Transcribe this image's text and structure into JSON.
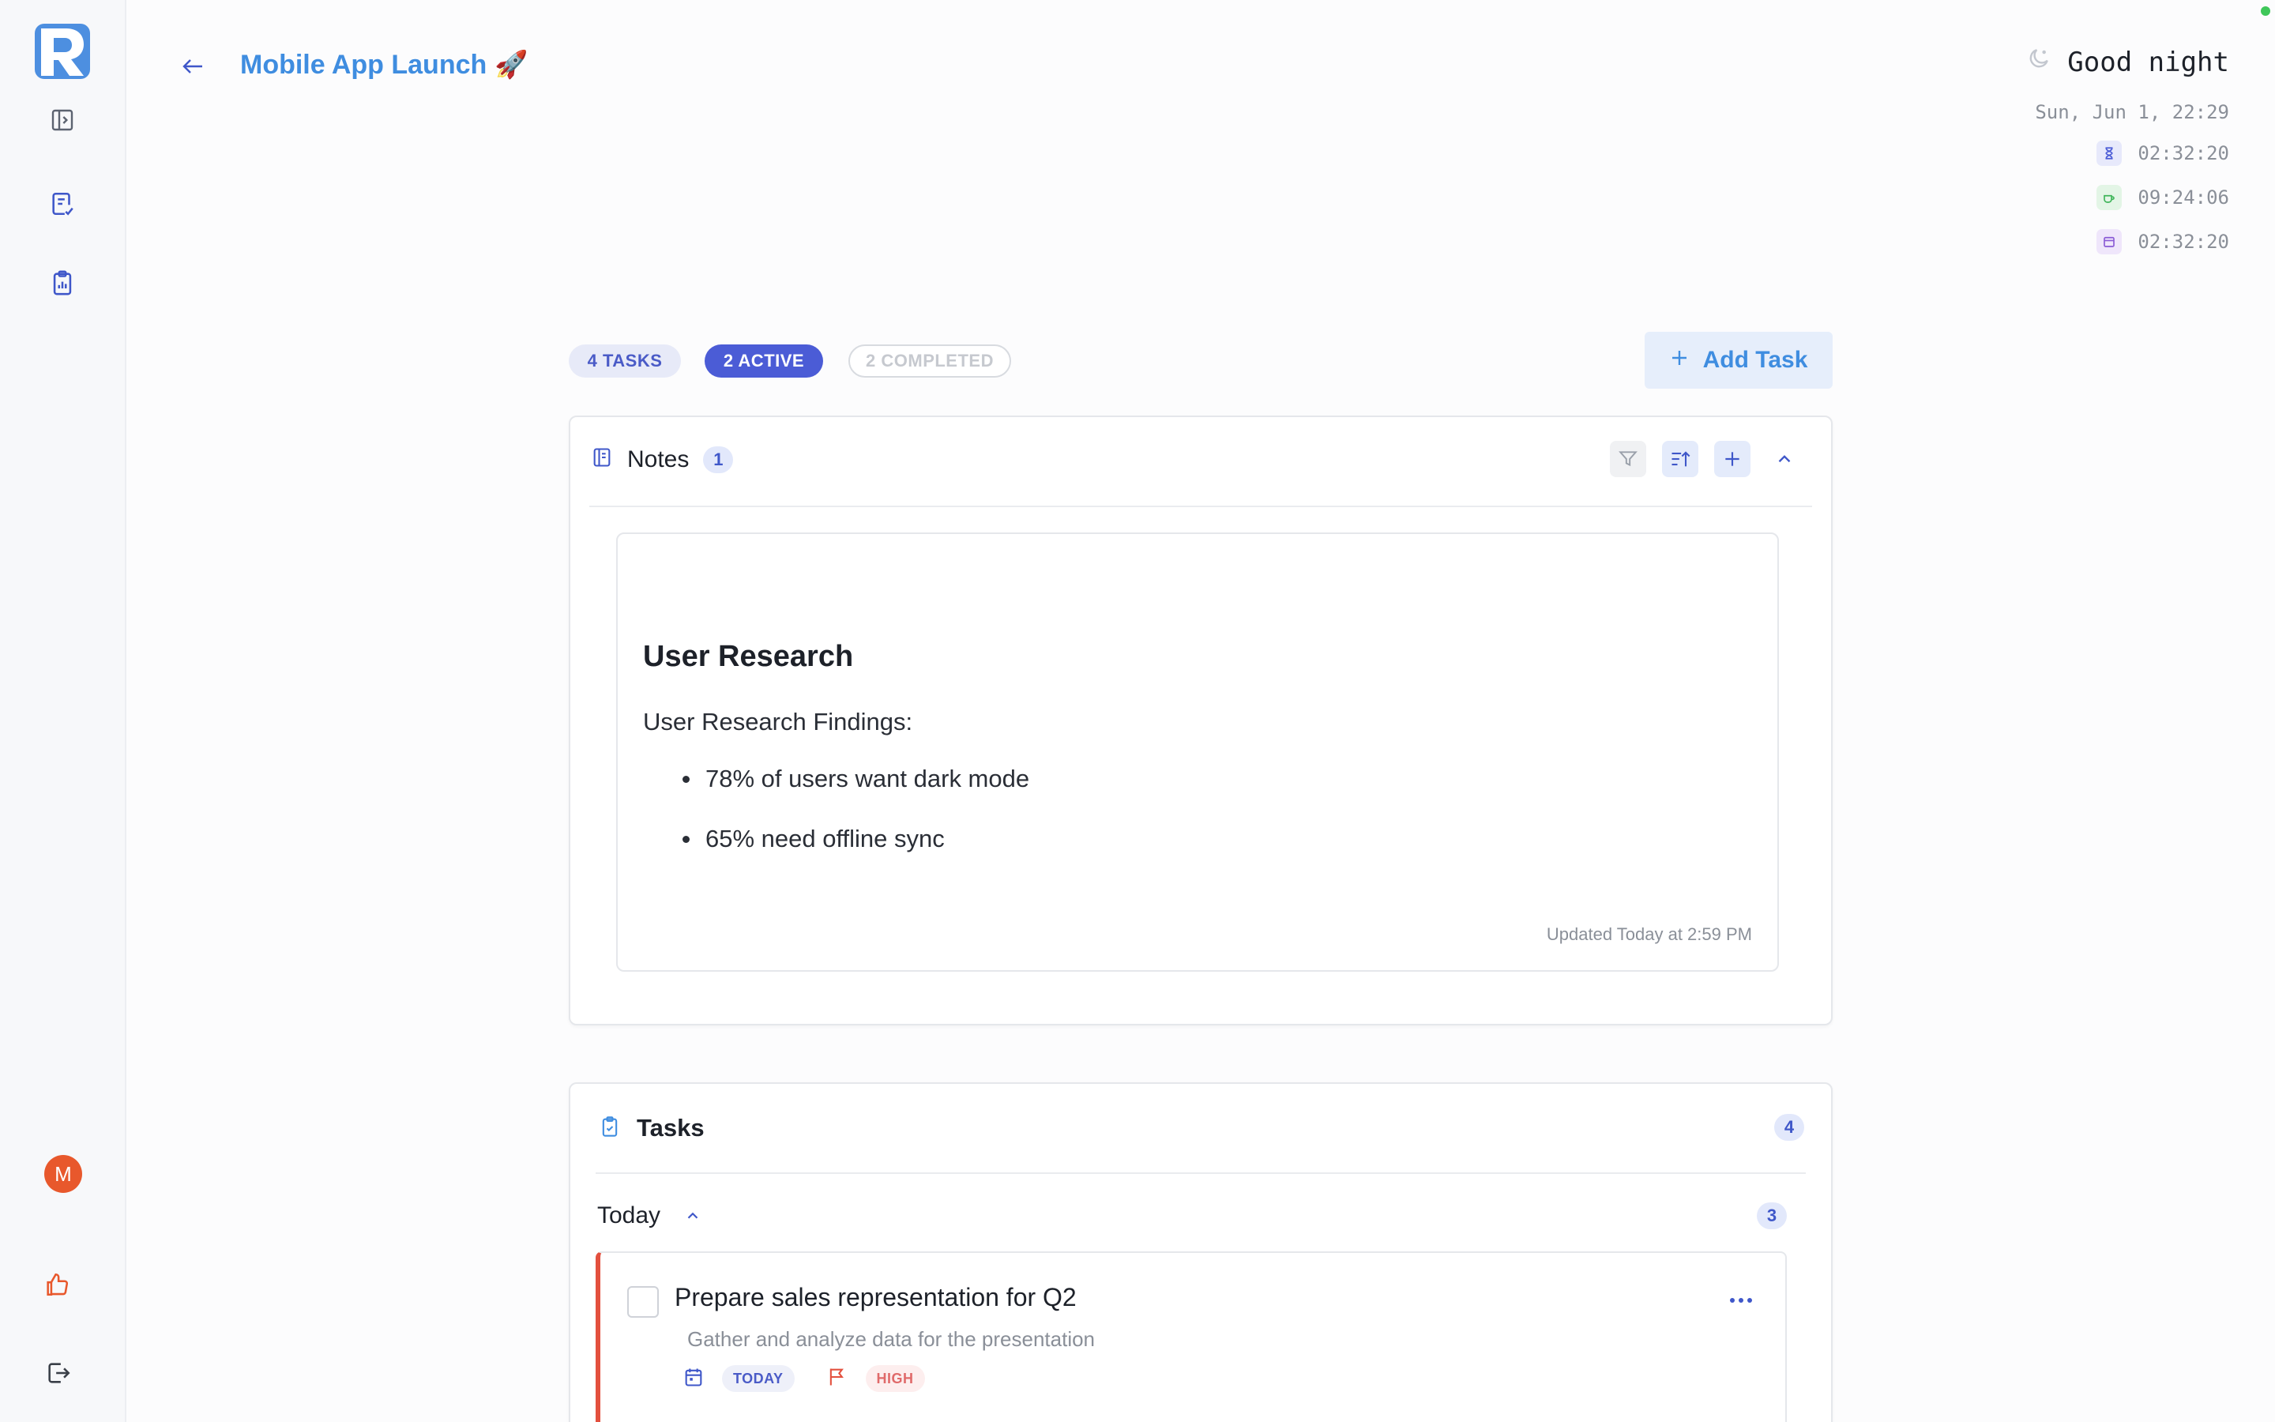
{
  "header": {
    "title": "Mobile App Launch",
    "title_emoji": "🚀"
  },
  "status": {
    "greeting": "Good night",
    "date": "Sun, Jun 1, 22:29",
    "timers": [
      "02:32:20",
      "09:24:06",
      "02:32:20"
    ]
  },
  "sidebar": {
    "avatar_initial": "M"
  },
  "filters": {
    "tasks": "4 TASKS",
    "active": "2 ACTIVE",
    "completed": "2 COMPLETED"
  },
  "toolbar": {
    "add_task": "Add Task"
  },
  "notes": {
    "label": "Notes",
    "count": "1",
    "items": [
      {
        "title": "User Research",
        "subtitle": "User Research Findings:",
        "bullets": [
          "78% of users want dark mode",
          "65% need offline sync"
        ],
        "updated": "Updated Today at 2:59 PM"
      }
    ]
  },
  "tasks": {
    "label": "Tasks",
    "count": "4",
    "groups": [
      {
        "label": "Today",
        "count": "3",
        "items": [
          {
            "title": "Prepare sales representation for Q2",
            "description": "Gather and analyze data for the presentation",
            "due_tag": "TODAY",
            "priority_tag": "HIGH"
          }
        ]
      }
    ]
  },
  "colors": {
    "accent": "#3f8de0",
    "indigo": "#4b5cd6",
    "priority_high": "#e3503e",
    "online": "#3fc75a"
  }
}
